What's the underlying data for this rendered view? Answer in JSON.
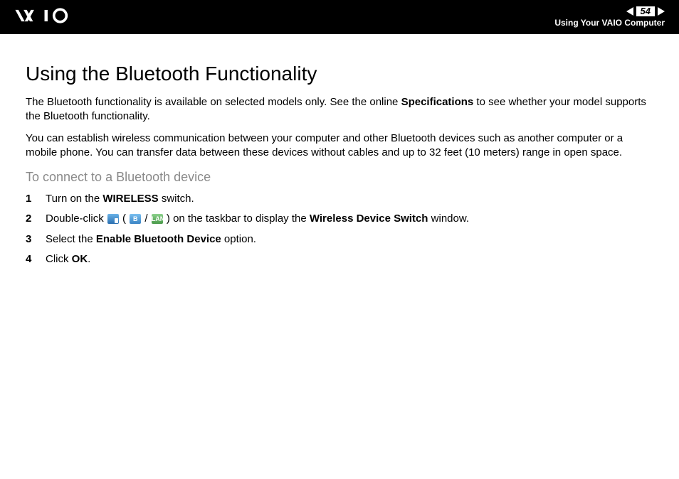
{
  "header": {
    "page_number": "54",
    "section": "Using Your VAIO Computer"
  },
  "content": {
    "title": "Using the Bluetooth Functionality",
    "para1_a": "The Bluetooth functionality is available on selected models only. See the online ",
    "para1_b": "Specifications",
    "para1_c": " to see whether your model supports the Bluetooth functionality.",
    "para2": "You can establish wireless communication between your computer and other Bluetooth devices such as another computer or a mobile phone. You can transfer data between these devices without cables and up to 32 feet (10 meters) range in open space.",
    "subtitle": "To connect to a Bluetooth device",
    "step1_a": "Turn on the ",
    "step1_b": "WIRELESS",
    "step1_c": " switch.",
    "step2_a": "Double-click ",
    "step2_b": " ( ",
    "step2_c": " / ",
    "step2_d": " ) on the taskbar to display the ",
    "step2_e": "Wireless Device Switch",
    "step2_f": " window.",
    "step3_a": "Select the ",
    "step3_b": "Enable Bluetooth Device",
    "step3_c": " option.",
    "step4_a": "Click ",
    "step4_b": "OK",
    "step4_c": ".",
    "icon_bt_label": "B",
    "icon_lan_label": "LAN"
  }
}
